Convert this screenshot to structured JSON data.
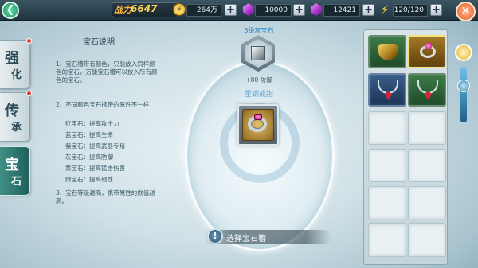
{
  "topbar": {
    "power_label": "战力",
    "power_value": "6647",
    "coins": "264万",
    "gems": "10000",
    "tickets": "12421",
    "energy": "120/120",
    "coin_glyph": "¥"
  },
  "side_tabs": [
    {
      "label": "强化",
      "c1": "强",
      "c2": "化",
      "active": false
    },
    {
      "label": "传承",
      "c1": "传",
      "c2": "承",
      "active": false
    },
    {
      "label": "宝石",
      "c1": "宝",
      "c2": "石",
      "active": true
    }
  ],
  "description": {
    "title": "宝石说明",
    "p1": "1、宝石槽带有颜色，只能放入同样颜色的宝石，万能宝石槽可以放入所有颜色的宝石。",
    "p2": "2、不同颜色宝石携带的属性不一样",
    "list": [
      "红宝石：提高攻击力",
      "蓝宝石：提高生命",
      "紫宝石：提高武器专精",
      "灰宝石：提高防御",
      "黄宝石：提高猛击伤害",
      "绿宝石：提高韧性"
    ],
    "p3": "3、宝石等级越高，携带属性的数值越高。"
  },
  "slot": {
    "gem_label": "5级灰宝石",
    "bonus": "+80 防御"
  },
  "equipped_item": {
    "name": "星钢戒指"
  },
  "prompt": {
    "icon": "!",
    "text": "选择宝石槽"
  },
  "inventory": [
    {
      "type": "armor",
      "style": "filled"
    },
    {
      "type": "ring",
      "style": "gold"
    },
    {
      "type": "necklace-red",
      "style": "blue"
    },
    {
      "type": "necklace-red",
      "style": "filled"
    },
    {
      "type": "empty"
    },
    {
      "type": "empty"
    },
    {
      "type": "empty"
    },
    {
      "type": "empty"
    },
    {
      "type": "empty"
    },
    {
      "type": "empty"
    },
    {
      "type": "empty"
    },
    {
      "type": "empty"
    }
  ],
  "colors": {
    "power": "#ffd75a",
    "slot_label": "#2b7fc2",
    "item_name": "#5fa6d3",
    "pendant_red": "#d0263a"
  },
  "icons": [
    "back-arrow-icon",
    "coin-icon",
    "purple-gem-icon",
    "ticket-gem-icon",
    "lightning-icon",
    "close-icon"
  ]
}
